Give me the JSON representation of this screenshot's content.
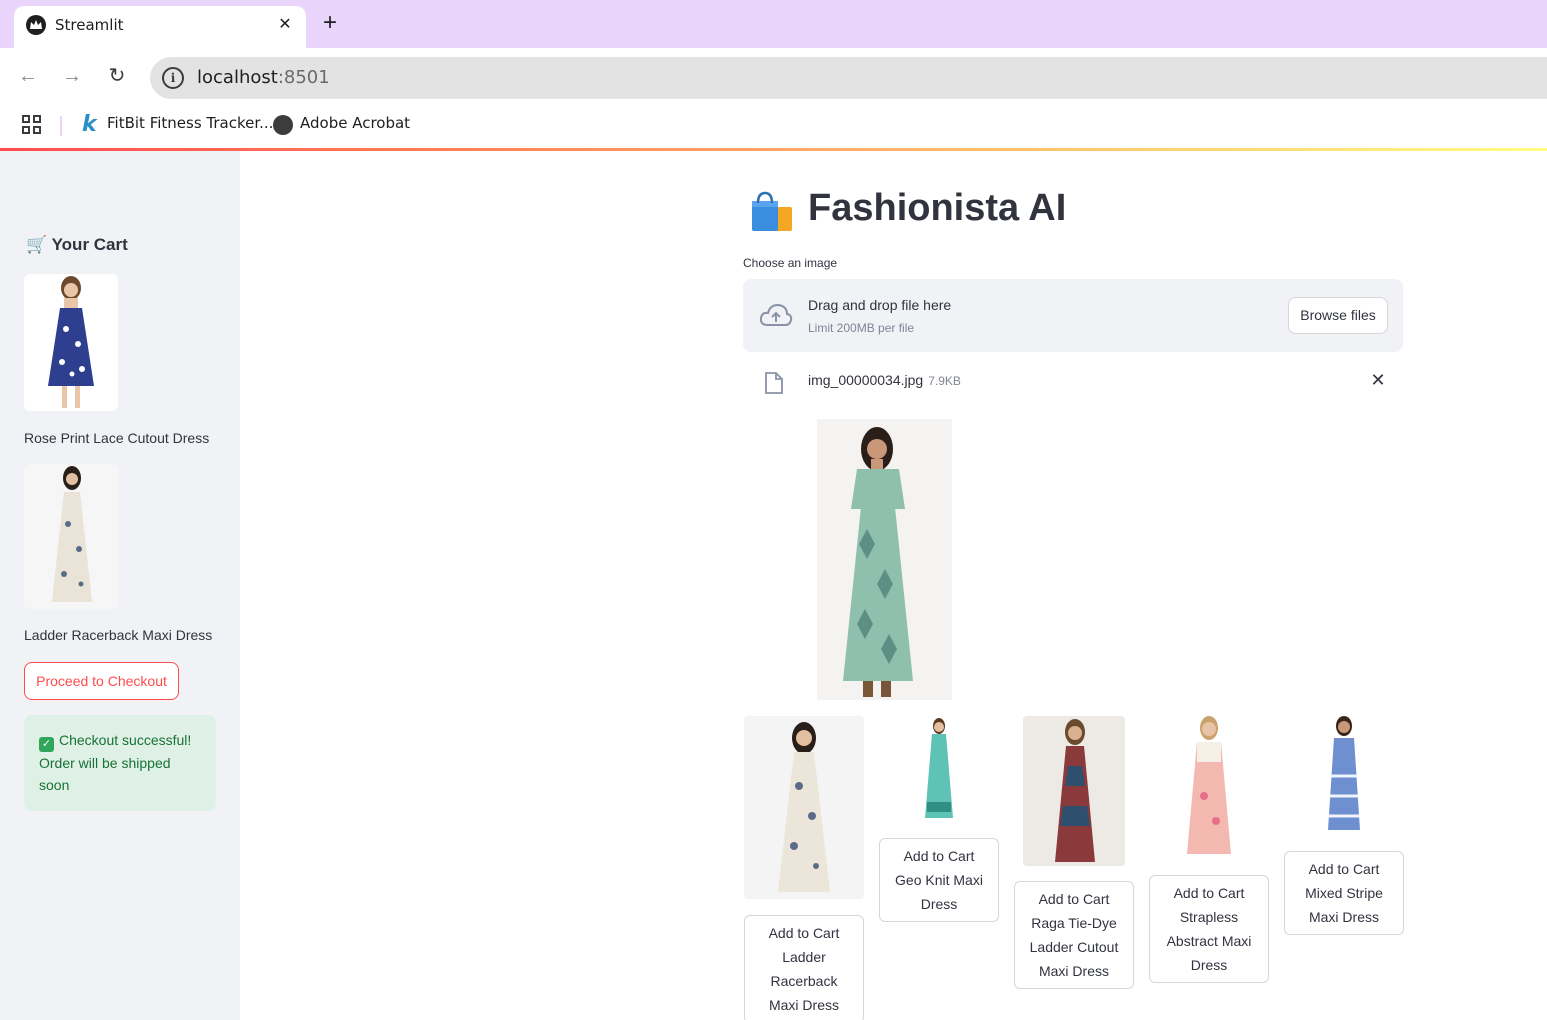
{
  "browser": {
    "tab_title": "Streamlit",
    "url_host": "localhost",
    "url_port": ":8501",
    "bookmarks": [
      "FitBit Fitness Tracker...",
      "Adobe Acrobat"
    ]
  },
  "sidebar": {
    "title": "Your Cart",
    "title_icon": "shopping-cart-icon",
    "items": [
      {
        "name": "Rose Print Lace Cutout Dress",
        "dress_color": "#2f3f8f"
      },
      {
        "name": "Ladder Racerback Maxi Dress",
        "dress_color": "#e9e3d8"
      }
    ],
    "checkout_label": "Proceed to Checkout",
    "success_message": "Checkout successful! Order will be shipped soon"
  },
  "main": {
    "title": "Fashionista AI",
    "title_icon": "shopping-bags-icon",
    "uploader": {
      "label": "Choose an image",
      "drop_text": "Drag and drop file here",
      "limit_text": "Limit 200MB per file",
      "browse_label": "Browse files",
      "file_name": "img_00000034.jpg",
      "file_size": "7.9KB"
    },
    "uploaded_image": {
      "dress_color": "#8fc0ad"
    },
    "recommendations": [
      {
        "label": "Add to Cart Ladder Racerback Maxi Dress",
        "dress_color": "#ece6da"
      },
      {
        "label": "Add to Cart Geo Knit Maxi Dress",
        "dress_color": "#5ec2b4"
      },
      {
        "label": "Add to Cart Raga Tie-Dye Ladder Cutout Maxi Dress",
        "dress_color": "#8a3a3a"
      },
      {
        "label": "Add to Cart Strapless Abstract Maxi Dress",
        "dress_color": "#f3b8b0"
      },
      {
        "label": "Add to Cart Mixed Stripe Maxi Dress",
        "dress_color": "#6e8fd0"
      }
    ]
  },
  "colors": {
    "accent": "#ff4b4b",
    "sidebar_bg": "#f0f2f6",
    "success_bg": "#dff1e7",
    "success_text": "#177233"
  }
}
